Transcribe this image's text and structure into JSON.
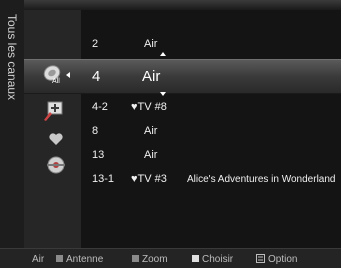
{
  "side_tab": {
    "label": "Tous les canaux"
  },
  "mode_icon": {
    "label": "All"
  },
  "channels": [
    {
      "number": "2",
      "name": "Air",
      "program": ""
    },
    {
      "number": "4",
      "name": "Air",
      "program": ""
    },
    {
      "number": "4-2",
      "name": "♥TV #8",
      "program": ""
    },
    {
      "number": "8",
      "name": "Air",
      "program": ""
    },
    {
      "number": "13",
      "name": "Air",
      "program": ""
    },
    {
      "number": "13-1",
      "name": "♥TV #3",
      "program": "Alice's Adventures in Wonderland"
    }
  ],
  "bottom_bar": {
    "source": "Air",
    "antenna": "Antenne",
    "zoom": "Zoom",
    "select": "Choisir",
    "option": "Option"
  },
  "colors": {
    "antenna_key": "#8a8a8a",
    "zoom_key": "#8a8a8a",
    "select_key": "#e0e0e0",
    "highlight": "#4a4a4a",
    "favorite": "#c8c8c8"
  }
}
